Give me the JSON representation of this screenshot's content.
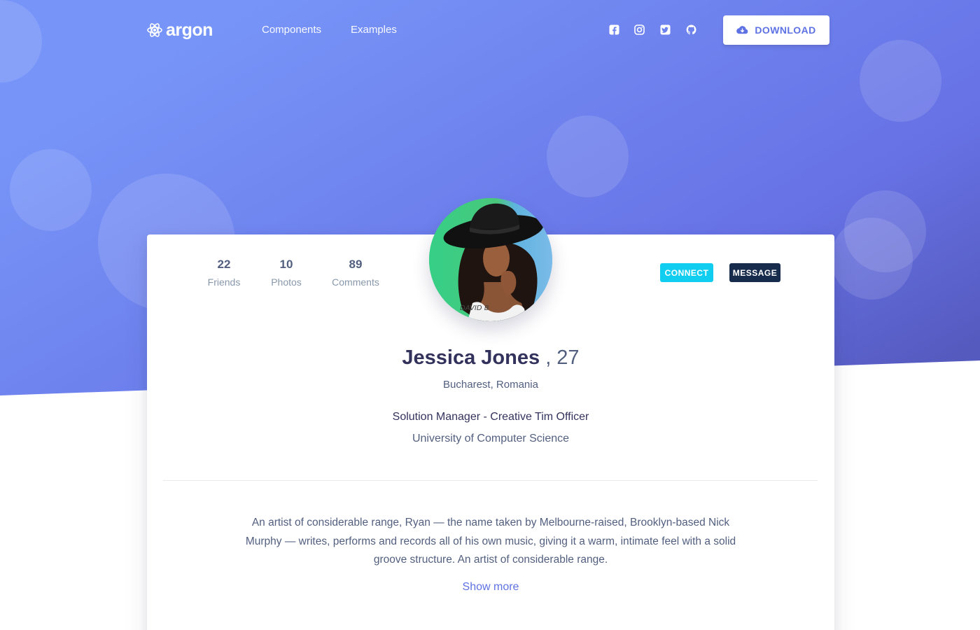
{
  "navbar": {
    "brand": "argon",
    "links": [
      "Components",
      "Examples"
    ],
    "social_icons": [
      "facebook-square-icon",
      "instagram-icon",
      "twitter-square-icon",
      "github-icon"
    ],
    "download_label": "DOWNLOAD"
  },
  "profile": {
    "stats": [
      {
        "value": "22",
        "label": "Friends"
      },
      {
        "value": "10",
        "label": "Photos"
      },
      {
        "value": "89",
        "label": "Comments"
      }
    ],
    "connect_label": "CONNECT",
    "message_label": "MESSAGE",
    "name": "Jessica Jones",
    "age": ", 27",
    "location": "Bucharest, Romania",
    "job": "Solution Manager - Creative Tim Officer",
    "school": "University of Computer Science",
    "bio": "An artist of considerable range, Ryan — the name taken by Melbourne-raised, Brooklyn-based Nick Murphy — writes, performs and records all of his own music, giving it a warm, intimate feel with a solid groove structure. An artist of considerable range.",
    "show_more_label": "Show more",
    "shirt_text": "DAVID B"
  },
  "colors": {
    "primary": "#5e72e4",
    "info": "#11cdef",
    "default": "#172b4d",
    "hero_gradient": [
      "#7795f8",
      "#6772e5",
      "#555abf"
    ]
  }
}
